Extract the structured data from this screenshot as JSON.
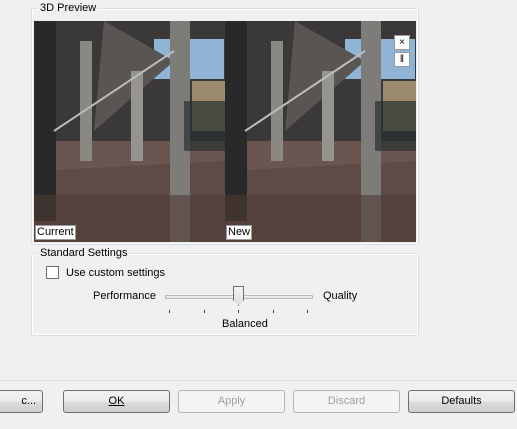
{
  "preview": {
    "title": "3D Preview",
    "label_current": "Current",
    "label_new": "New",
    "close_symbol": "×",
    "split_symbol": "‖"
  },
  "standard": {
    "title": "Standard Settings",
    "custom_label": "Use custom settings",
    "custom_checked": false,
    "perf_label": "Performance",
    "quality_label": "Quality",
    "slider_level_fraction": 0.5,
    "slider_tick_count": 5,
    "balanced_label": "Balanced"
  },
  "buttons": {
    "etc": "c...",
    "ok": "OK",
    "apply": "Apply",
    "discard": "Discard",
    "defaults": "Defaults"
  },
  "colors": {
    "preview_bg": "#1e1e1e",
    "sky": "#8fb4d6",
    "floor": "#6b5550",
    "stone": "#7d7c78"
  }
}
